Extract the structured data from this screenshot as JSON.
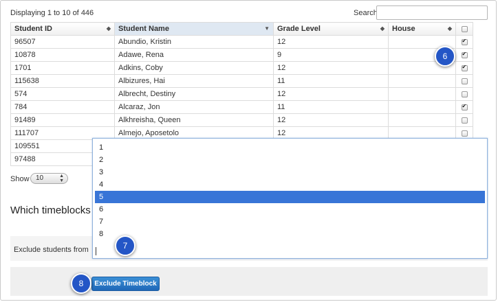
{
  "pagination": {
    "prefix": "Displaying",
    "from": "1",
    "to_word": "to",
    "to": "10",
    "of_word": "of",
    "total": "446"
  },
  "search": {
    "label": "Search",
    "value": ""
  },
  "table": {
    "columns": [
      "Student ID",
      "Student Name",
      "Grade Level",
      "House"
    ],
    "rows": [
      {
        "id": "96507",
        "name": "Abundio, Kristin",
        "grade": "12",
        "house": "",
        "checked": true
      },
      {
        "id": "10878",
        "name": "Adawe, Rena",
        "grade": "9",
        "house": "",
        "checked": true
      },
      {
        "id": "1701",
        "name": "Adkins, Coby",
        "grade": "12",
        "house": "",
        "checked": true
      },
      {
        "id": "115638",
        "name": "Albizures, Hai",
        "grade": "11",
        "house": "",
        "checked": false
      },
      {
        "id": "574",
        "name": "Albrecht, Destiny",
        "grade": "12",
        "house": "",
        "checked": false
      },
      {
        "id": "784",
        "name": "Alcaraz, Jon",
        "grade": "11",
        "house": "",
        "checked": true
      },
      {
        "id": "91489",
        "name": "Alkhreisha, Queen",
        "grade": "12",
        "house": "",
        "checked": false
      },
      {
        "id": "111707",
        "name": "Almejo, Aposetolo",
        "grade": "12",
        "house": "",
        "checked": false
      },
      {
        "id": "109551",
        "name": "",
        "grade": "",
        "house": "",
        "checked": false
      },
      {
        "id": "97488",
        "name": "",
        "grade": "",
        "house": "",
        "checked": false
      }
    ]
  },
  "show": {
    "label": "Show",
    "value": "10"
  },
  "section_title": "Which timeblocks",
  "exclude": {
    "label": "Exclude students from",
    "button_label": "Exclude Timeblock"
  },
  "dropdown": {
    "options": [
      "1",
      "2",
      "3",
      "4",
      "5",
      "6",
      "7",
      "8"
    ],
    "selected": "5"
  },
  "markers": {
    "m6": "6",
    "m7": "7",
    "m8": "8"
  },
  "colors": {
    "accent": "#2456c6",
    "selected_option": "#3875d7",
    "button": "#1f68b8"
  }
}
